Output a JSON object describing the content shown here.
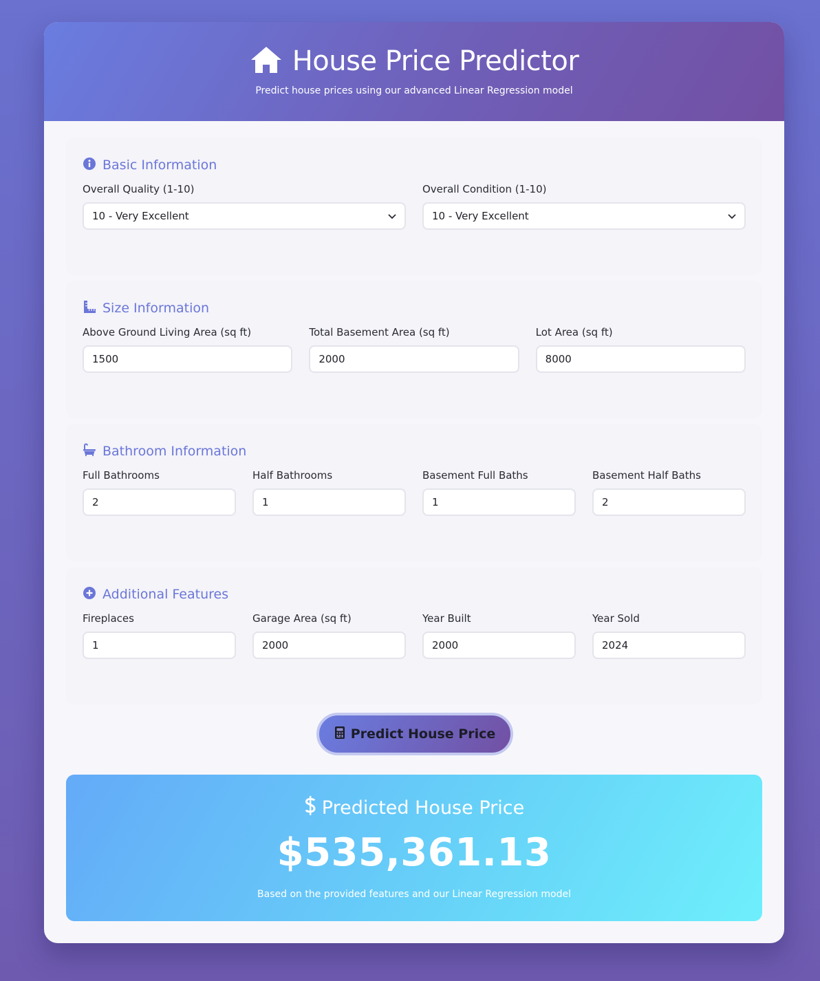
{
  "header": {
    "title": "House Price Predictor",
    "subtitle": "Predict house prices using our advanced Linear Regression model",
    "icon": "home-icon"
  },
  "sections": {
    "basic": {
      "title": "Basic Information",
      "icon": "info-circle-icon",
      "fields": [
        {
          "label": "Overall Quality (1-10)",
          "value": "10 - Very Excellent"
        },
        {
          "label": "Overall Condition (1-10)",
          "value": "10 - Very Excellent"
        }
      ]
    },
    "size": {
      "title": "Size Information",
      "icon": "ruler-icon",
      "fields": [
        {
          "label": "Above Ground Living Area (sq ft)",
          "value": "1500"
        },
        {
          "label": "Total Basement Area (sq ft)",
          "value": "2000"
        },
        {
          "label": "Lot Area (sq ft)",
          "value": "8000"
        }
      ]
    },
    "bath": {
      "title": "Bathroom Information",
      "icon": "bath-icon",
      "fields": [
        {
          "label": "Full Bathrooms",
          "value": "2"
        },
        {
          "label": "Half Bathrooms",
          "value": "1"
        },
        {
          "label": "Basement Full Baths",
          "value": "1"
        },
        {
          "label": "Basement Half Baths",
          "value": "2"
        }
      ]
    },
    "extra": {
      "title": "Additional Features",
      "icon": "plus-circle-icon",
      "fields": [
        {
          "label": "Fireplaces",
          "value": "1"
        },
        {
          "label": "Garage Area (sq ft)",
          "value": "2000"
        },
        {
          "label": "Year Built",
          "value": "2000"
        },
        {
          "label": "Year Sold",
          "value": "2024"
        }
      ]
    }
  },
  "predict_button": {
    "label": "Predict House Price",
    "icon": "calculator-icon"
  },
  "result": {
    "title": "Predicted House Price",
    "icon": "dollar-icon",
    "value": "$535,361.13",
    "note": "Based on the provided features and our Linear Regression model"
  },
  "colors": {
    "accent": "#6b76d8",
    "header_start": "#6a7de0",
    "header_end": "#7250a3",
    "result_start": "#64aaf8",
    "result_end": "#6eeffc"
  }
}
